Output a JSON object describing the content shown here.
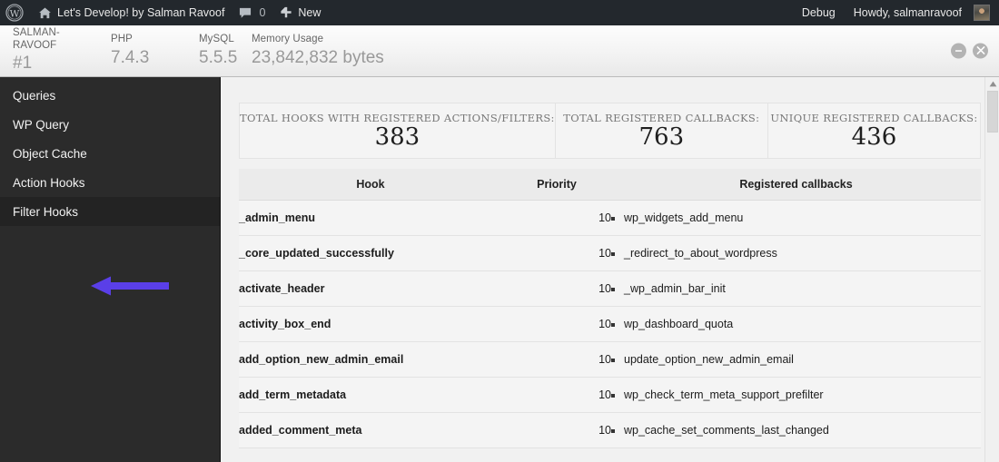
{
  "adminbar": {
    "wp_logo_icon": "wordpress-logo-icon",
    "site_home_icon": "home-icon",
    "site_name": "Let's Develop! by Salman Ravoof",
    "comments_icon": "comment-bubble-icon",
    "comments_count": "0",
    "new_icon": "plus-icon",
    "new_label": "New",
    "debug_label": "Debug",
    "howdy_label": "Howdy, salmanravoof",
    "avatar_icon": "user-avatar"
  },
  "panel_header": {
    "stats": [
      {
        "label": "SALMAN-RAVOOF",
        "value": "#1"
      },
      {
        "label": "PHP",
        "value": "7.4.3"
      },
      {
        "label": "MySQL",
        "value": "5.5.5"
      },
      {
        "label": "Memory Usage",
        "value": "23,842,832 bytes"
      }
    ],
    "minimize_icon": "minimize-icon",
    "close_icon": "close-icon"
  },
  "sidebar": {
    "items": [
      {
        "label": "Queries",
        "active": false
      },
      {
        "label": "WP Query",
        "active": false
      },
      {
        "label": "Object Cache",
        "active": false
      },
      {
        "label": "Action Hooks",
        "active": false
      },
      {
        "label": "Filter Hooks",
        "active": true
      }
    ],
    "annotation_arrow": {
      "name": "pointer-arrow",
      "color": "#5a3fe8",
      "points_to": "Filter Hooks"
    }
  },
  "summary": {
    "boxes": [
      {
        "caption": "Total hooks with registered actions/filters:",
        "value": "383"
      },
      {
        "caption": "Total registered callbacks:",
        "value": "763"
      },
      {
        "caption": "Unique registered callbacks:",
        "value": "436"
      }
    ]
  },
  "table": {
    "columns": [
      "Hook",
      "Priority",
      "Registered callbacks"
    ],
    "rows": [
      {
        "hook": "_admin_menu",
        "priority": "10",
        "callbacks": [
          "wp_widgets_add_menu"
        ]
      },
      {
        "hook": "_core_updated_successfully",
        "priority": "10",
        "callbacks": [
          "_redirect_to_about_wordpress"
        ]
      },
      {
        "hook": "activate_header",
        "priority": "10",
        "callbacks": [
          "_wp_admin_bar_init"
        ]
      },
      {
        "hook": "activity_box_end",
        "priority": "10",
        "callbacks": [
          "wp_dashboard_quota"
        ]
      },
      {
        "hook": "add_option_new_admin_email",
        "priority": "10",
        "callbacks": [
          "update_option_new_admin_email"
        ]
      },
      {
        "hook": "add_term_metadata",
        "priority": "10",
        "callbacks": [
          "wp_check_term_meta_support_prefilter"
        ]
      },
      {
        "hook": "added_comment_meta",
        "priority": "10",
        "callbacks": [
          "wp_cache_set_comments_last_changed"
        ]
      }
    ]
  },
  "scrollbar": {
    "up_arrow_icon": "scroll-up-arrow-icon",
    "thumb_name": "scrollbar-thumb"
  },
  "colors": {
    "adminbar_bg": "#23282d",
    "sidebar_bg": "#2b2b2b",
    "sidebar_active_bg": "#232323",
    "content_bg": "#f1f1f1",
    "arrow_accent": "#5a3fe8"
  }
}
